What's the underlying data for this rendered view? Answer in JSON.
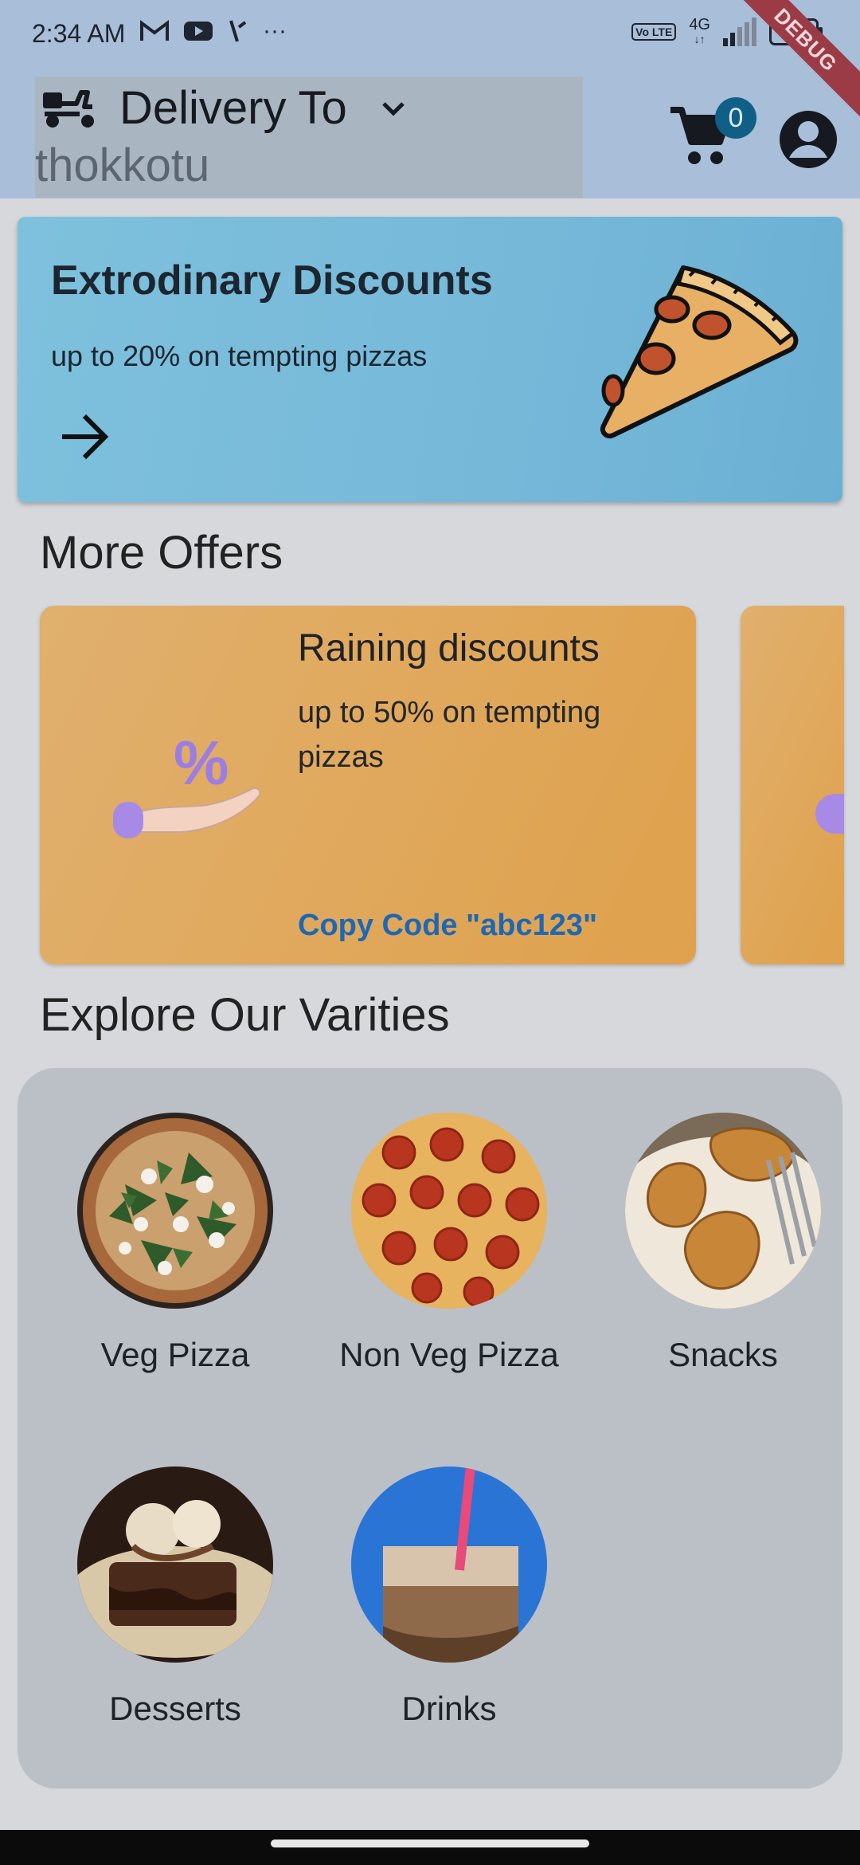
{
  "status_bar": {
    "time": "2:34 AM",
    "network": "4G",
    "volte": "Vo LTE",
    "battery": "4"
  },
  "debug_banner": "DEBUG",
  "header": {
    "delivery_label": "Delivery To",
    "location": "thokkotu",
    "cart_count": "0"
  },
  "banner": {
    "title": "Extrodinary Discounts",
    "subtitle": "up to 20% on tempting pizzas"
  },
  "offers": {
    "heading": "More Offers",
    "items": [
      {
        "title": "Raining discounts",
        "subtitle": "up to 50% on tempting pizzas",
        "code_label": "Copy Code \"abc123\""
      }
    ]
  },
  "varieties": {
    "heading": "Explore Our Varities",
    "items": [
      {
        "label": "Veg Pizza"
      },
      {
        "label": "Non Veg Pizza"
      },
      {
        "label": "Snacks"
      },
      {
        "label": "Desserts"
      },
      {
        "label": "Drinks"
      }
    ]
  },
  "colors": {
    "app_bar": "#a9bed8",
    "banner": "#76b8d8",
    "offer_card": "#dfa14c",
    "code_link": "#1d68b4",
    "cart_badge": "#0f5f86"
  }
}
